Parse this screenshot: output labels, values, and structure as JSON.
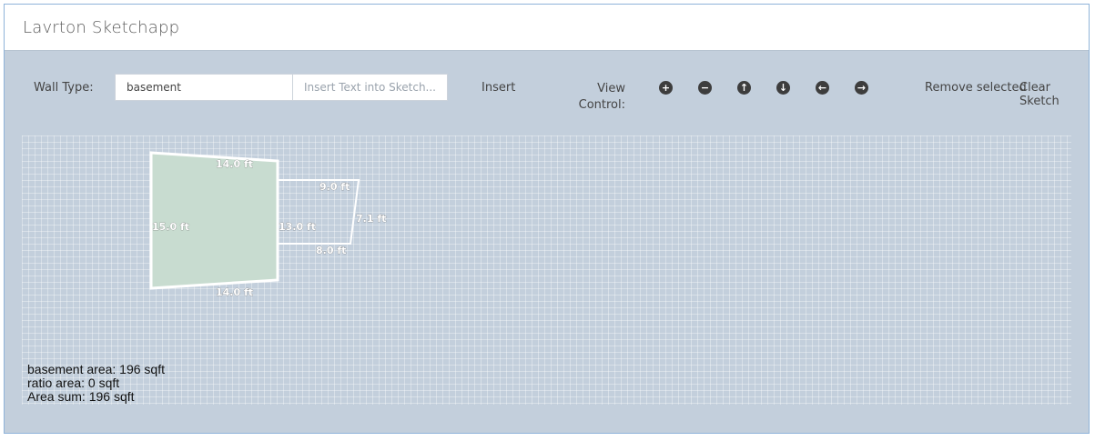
{
  "app": {
    "title": "Lavrton Sketchapp"
  },
  "toolbar": {
    "wall_type_label": "Wall Type:",
    "wall_type_value": "basement",
    "text_placeholder": "Insert Text into Sketch...",
    "insert_label": "Insert",
    "view_control_label": "View Control:",
    "view_buttons": [
      {
        "icon": "zoom-in-icon",
        "glyph": "+"
      },
      {
        "icon": "zoom-out-icon",
        "glyph": "−"
      },
      {
        "icon": "pan-up-icon",
        "glyph": "↑"
      },
      {
        "icon": "pan-down-icon",
        "glyph": "↓"
      },
      {
        "icon": "pan-left-icon",
        "glyph": "←"
      },
      {
        "icon": "pan-right-icon",
        "glyph": "→"
      }
    ],
    "remove_selected_label": "Remove selected",
    "clear_sketch_label": "Clear Sketch"
  },
  "sketch": {
    "shapes": [
      {
        "type": "basement",
        "fill": "#c8dcd0",
        "walls": [
          "14.0 ft",
          "13.0 ft",
          "14.0 ft",
          "15.0 ft"
        ]
      },
      {
        "type": "ratio",
        "fill": "none",
        "walls": [
          "9.0 ft",
          "7.1 ft",
          "8.0 ft"
        ]
      }
    ],
    "dimension_labels": {
      "basement_top": "14.0 ft",
      "basement_left": "15.0 ft",
      "basement_right": "13.0 ft",
      "basement_bottom": "14.0 ft",
      "ratio_top": "9.0 ft",
      "ratio_right": "7.1 ft",
      "ratio_bottom": "8.0 ft"
    }
  },
  "areas": {
    "basement": "basement area: 196 sqft",
    "ratio": "ratio area: 0 sqft",
    "sum": "Area sum: 196 sqft"
  }
}
